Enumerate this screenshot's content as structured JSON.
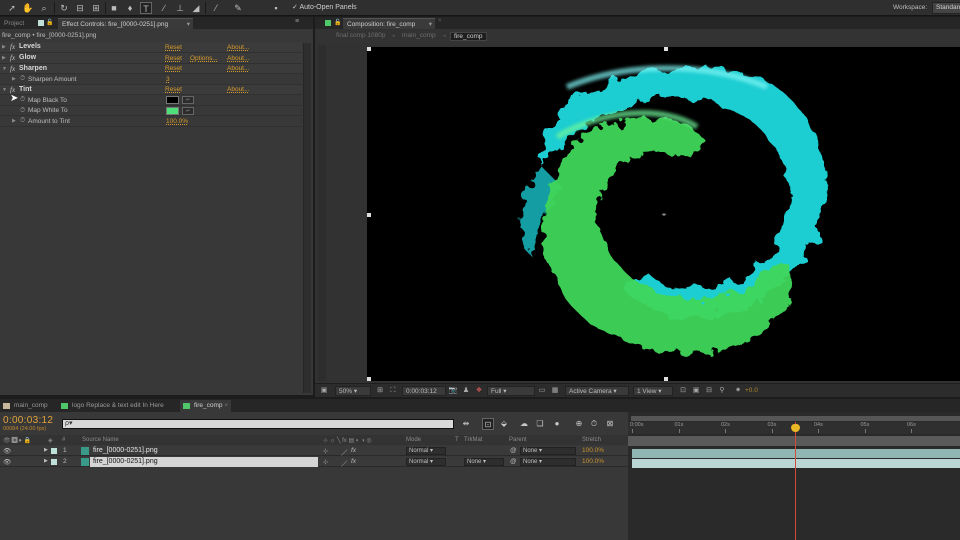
{
  "toolbar": {
    "tools": [
      "selection-tool",
      "hand-tool",
      "zoom-tool",
      "rotation-tool",
      "camera-tool",
      "pan-behind-tool",
      "rectangle-tool",
      "pen-tool",
      "type-tool",
      "brush-tool",
      "clone-stamp-tool",
      "eraser-tool",
      "roto-brush-tool",
      "puppet-pin-tool"
    ],
    "auto_open_label": "Auto-Open Panels",
    "auto_open_checked": true,
    "workspace_label": "Workspace:",
    "workspace_value": "Standard"
  },
  "left_panel": {
    "tabs": [
      {
        "label": "Project",
        "active": false
      },
      {
        "label": "Effect Controls: fire_[0000-0251].png",
        "active": true
      }
    ],
    "breadcrumb": "fire_comp • fire_[0000-0251].png",
    "effects": [
      {
        "name": "Levels",
        "expanded": false,
        "reset": "Reset",
        "options": "",
        "about": "About..."
      },
      {
        "name": "Glow",
        "expanded": false,
        "reset": "Reset",
        "options": "Options...",
        "about": "About..."
      },
      {
        "name": "Sharpen",
        "expanded": true,
        "reset": "Reset",
        "options": "",
        "about": "About...",
        "params": [
          {
            "name": "Sharpen Amount",
            "value": "3"
          }
        ]
      },
      {
        "name": "Tint",
        "expanded": true,
        "reset": "Reset",
        "options": "",
        "about": "About...",
        "params": [
          {
            "name": "Map Black To",
            "color": "#000000"
          },
          {
            "name": "Map White To",
            "color": "#4fe07a"
          },
          {
            "name": "Amount to Tint",
            "value": "100.0%"
          }
        ]
      }
    ]
  },
  "comp_panel": {
    "tab_label": "Composition: fire_comp",
    "breadcrumbs": [
      {
        "label": "final comp 1080p",
        "current": false
      },
      {
        "label": "main_comp",
        "current": false
      },
      {
        "label": "fire_comp",
        "current": true
      }
    ],
    "footer": {
      "magnification": "50%",
      "timecode": "0:00:03:12",
      "resolution": "Full",
      "view": "Active Camera",
      "layout": "1 View",
      "exposure": "+0.0"
    }
  },
  "timeline": {
    "tabs": [
      {
        "label": "main_comp",
        "color": "#c8b89a",
        "active": false
      },
      {
        "label": "logo Replace & text edit In Here",
        "color": "#4fc86a",
        "active": false
      },
      {
        "label": "fire_comp",
        "color": "#4fc86a",
        "active": true
      }
    ],
    "timecode": "0:00:03:12",
    "frame_info": "00084 (24.00 fps)",
    "search_placeholder": "ρ▾",
    "columns": {
      "source_name": "Source Name",
      "mode": "Mode",
      "trkmat": "TrkMat",
      "parent": "Parent",
      "stretch": "Stretch"
    },
    "layers": [
      {
        "num": "1",
        "name": "fire_[0000-0251].png",
        "mode": "Normal",
        "trkmat": "",
        "parent": "None",
        "stretch": "100.0%",
        "selected": false
      },
      {
        "num": "2",
        "name": "fire_[0000-0251].png",
        "mode": "Normal",
        "trkmat": "None",
        "parent": "None",
        "stretch": "100.0%",
        "selected": true
      }
    ],
    "ruler_ticks": [
      "0:00s",
      "01s",
      "02s",
      "03s",
      "04s",
      "05s",
      "06s"
    ],
    "playhead_seconds": 3.5,
    "colors": {
      "timecode": "#e3a43c",
      "playhead": "#d34c3a",
      "layer1_bar": "#8fb6b3",
      "layer2_bar": "#b9d6d5"
    }
  }
}
